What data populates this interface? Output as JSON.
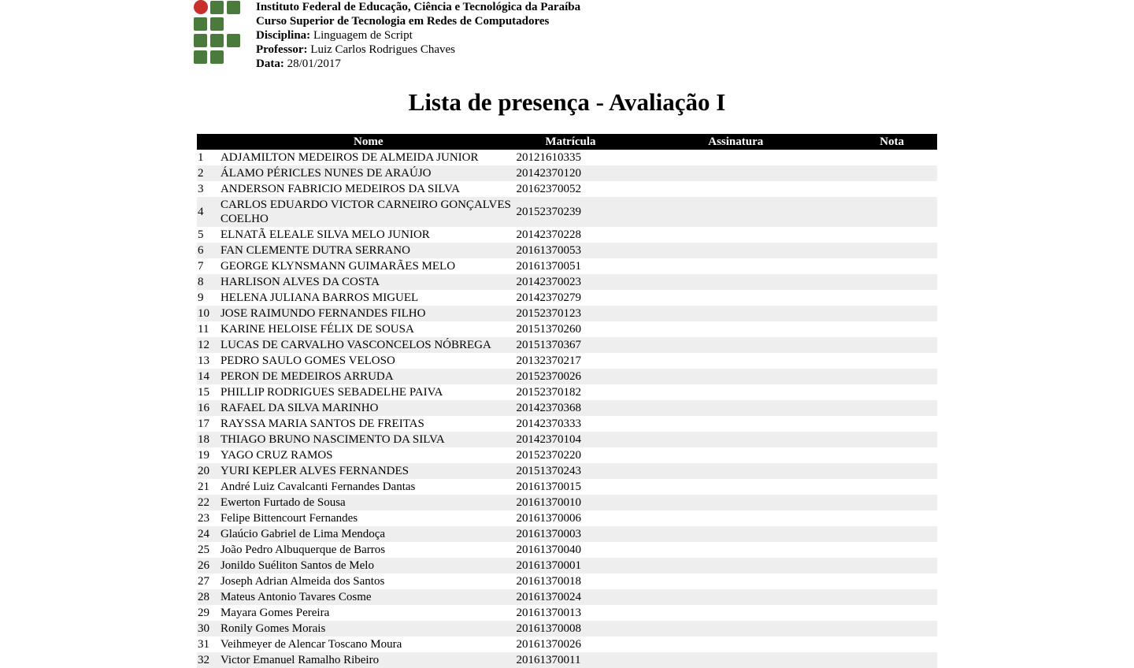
{
  "header": {
    "institution": "Instituto Federal de Educação, Ciência e Tecnológica da Paraíba",
    "course": "Curso Superior de Tecnologia em Redes de Computadores",
    "discipline_label": "Disciplina:",
    "discipline": "Linguagem de Script",
    "professor_label": "Professor:",
    "professor": "Luiz Carlos Rodrigues Chaves",
    "date_label": "Data:",
    "date": "28/01/2017"
  },
  "logo": {
    "colors": {
      "circle": "#c8302c",
      "squares": "#4a7a3c"
    }
  },
  "title": "Lista de presença - Avaliação I",
  "table": {
    "columns": [
      "",
      "Nome",
      "Matrícula",
      "Assinatura",
      "Nota"
    ],
    "rows": [
      {
        "num": "1",
        "name": "ADJAMILTON MEDEIROS DE ALMEIDA JUNIOR",
        "matricula": "20121610335"
      },
      {
        "num": "2",
        "name": "ÁLAMO PÉRICLES NUNES DE ARAÚJO",
        "matricula": "20142370120"
      },
      {
        "num": "3",
        "name": "ANDERSON FABRICIO MEDEIROS DA SILVA",
        "matricula": "20162370052"
      },
      {
        "num": "4",
        "name": "CARLOS EDUARDO VICTOR CARNEIRO GONÇALVES COELHO",
        "matricula": "20152370239"
      },
      {
        "num": "5",
        "name": "ELNATÃ ELEALE SILVA MELO JUNIOR",
        "matricula": "20142370228"
      },
      {
        "num": "6",
        "name": "FAN CLEMENTE DUTRA SERRANO",
        "matricula": "20161370053"
      },
      {
        "num": "7",
        "name": "GEORGE KLYNSMANN GUIMARÃES MELO",
        "matricula": "20161370051"
      },
      {
        "num": "8",
        "name": "HARLISON ALVES DA COSTA",
        "matricula": "20142370023"
      },
      {
        "num": "9",
        "name": "HELENA JULIANA BARROS MIGUEL",
        "matricula": "20142370279"
      },
      {
        "num": "10",
        "name": "JOSE RAIMUNDO FERNANDES FILHO",
        "matricula": "20152370123"
      },
      {
        "num": "11",
        "name": "KARINE HELOISE FÉLIX DE SOUSA",
        "matricula": "20151370260"
      },
      {
        "num": "12",
        "name": "LUCAS DE CARVALHO VASCONCELOS NÓBREGA",
        "matricula": "20151370367"
      },
      {
        "num": "13",
        "name": "PEDRO SAULO GOMES VELOSO",
        "matricula": "20132370217"
      },
      {
        "num": "14",
        "name": "PERON DE MEDEIROS ARRUDA",
        "matricula": "20152370026"
      },
      {
        "num": "15",
        "name": "PHILLIP RODRIGUES SEBADELHE PAIVA",
        "matricula": "20152370182"
      },
      {
        "num": "16",
        "name": "RAFAEL DA SILVA MARINHO",
        "matricula": "20142370368"
      },
      {
        "num": "17",
        "name": "RAYSSA MARIA SANTOS DE FREITAS",
        "matricula": "20142370333"
      },
      {
        "num": "18",
        "name": "THIAGO BRUNO NASCIMENTO DA SILVA",
        "matricula": "20142370104"
      },
      {
        "num": "19",
        "name": "YAGO CRUZ RAMOS",
        "matricula": "20152370220"
      },
      {
        "num": "20",
        "name": "YURI KEPLER ALVES FERNANDES",
        "matricula": "20151370243"
      },
      {
        "num": "21",
        "name": "André Luiz Cavalcanti Fernandes Dantas",
        "matricula": "20161370015"
      },
      {
        "num": "22",
        "name": "Ewerton Furtado de Sousa",
        "matricula": "20161370010"
      },
      {
        "num": "23",
        "name": "Felipe Bittencourt Fernandes",
        "matricula": "20161370006"
      },
      {
        "num": "24",
        "name": "Glaúcio Gabriel de Lima Mendoça",
        "matricula": "20161370003"
      },
      {
        "num": "25",
        "name": "João Pedro Albuquerque de Barros",
        "matricula": "20161370040"
      },
      {
        "num": "26",
        "name": "Jonildo Suéliton Santos de Melo",
        "matricula": "20161370001"
      },
      {
        "num": "27",
        "name": "Joseph Adrian Almeida dos Santos",
        "matricula": "20161370018"
      },
      {
        "num": "28",
        "name": "Mateus Antonio Tavares Cosme",
        "matricula": "20161370024"
      },
      {
        "num": "29",
        "name": "Mayara Gomes Pereira",
        "matricula": "20161370013"
      },
      {
        "num": "30",
        "name": "Ronily Gomes Morais",
        "matricula": "20161370008"
      },
      {
        "num": "31",
        "name": "Veihmeyer de Alencar Toscano Moura",
        "matricula": "20161370026"
      },
      {
        "num": "32",
        "name": "Victor Emanuel Ramalho Ribeiro",
        "matricula": "20161370011"
      }
    ]
  }
}
